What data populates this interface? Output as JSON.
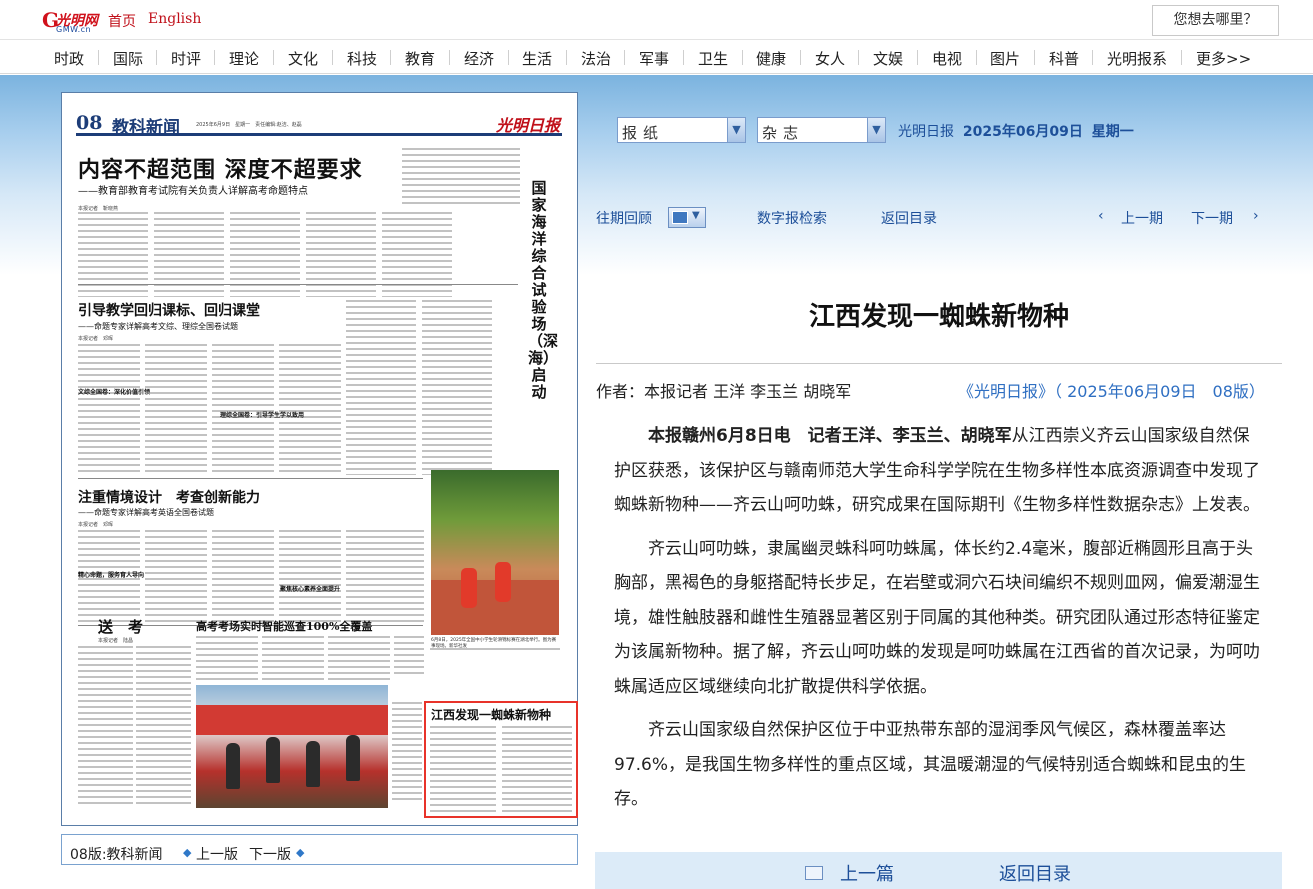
{
  "site": {
    "logo_cn": "光明网",
    "logo_en": "GMW.cn",
    "links": [
      "首页",
      "English"
    ],
    "search_button": "您想去哪里？"
  },
  "nav": {
    "items": [
      "时政",
      "国际",
      "时评",
      "理论",
      "文化",
      "科技",
      "教育",
      "经济",
      "生活",
      "法治",
      "军事",
      "卫生",
      "健康",
      "女人",
      "文娱",
      "电视",
      "图片",
      "科普",
      "光明报系",
      "更多>>"
    ]
  },
  "paper": {
    "page_no": "08",
    "page_name": "教科新闻",
    "meta": "2025年6月9日　星期一　责任编辑:赵洁、赵磊",
    "logo": "光明日报",
    "headline": "内容不超范围 深度不超要求",
    "subhead": "——教育部教育考试院有关负责人详解高考命题特点",
    "byline1": "本报记者　靳晓燕",
    "h2a": "引导教学回归课标、回归课堂",
    "h2a_sub": "——命题专家详解高考文综、理综全国卷试题",
    "byline2": "本报记者　邓晖",
    "h3a": "文综全国卷：深化价值引领",
    "h3b": "理综全国卷：引导学生学以致用",
    "h2b": "注重情境设计　考查创新能力",
    "h2b_sub": "——命题专家详解高考英语全国卷试题",
    "byline3": "本报记者　邓晖",
    "h3c": "精心命题，服务育人导向",
    "h2c": "送　考",
    "byline4": "本报记者　陆昌",
    "h2d": "高考考场实时智能巡查100%全覆盖",
    "h3d": "聚焦核心素养全面提升",
    "vertical_title": "国家海洋综合试验场（深海）启动",
    "photo_caption": "6月8日，2025年全国中小学生轮滑锦标赛在湖北举行。图为赛事现场。新华社发",
    "highlight_title": "江西发现一蜘蛛新物种"
  },
  "paper_nav": {
    "page_label": "08版:教科新闻",
    "prev": "上一版",
    "next": "下一版"
  },
  "selectors": {
    "newspaper": "报纸",
    "magazine": "杂志"
  },
  "date_line": {
    "paper_name": "光明日报",
    "date": "2025年06月09日",
    "weekday": "星期一"
  },
  "toolbar": {
    "history": "往期回顾",
    "search": "数字报检索",
    "back": "返回目录",
    "prev_issue": "上一期",
    "next_issue": "下一期"
  },
  "article": {
    "title": "江西发现一蜘蛛新物种",
    "author": "作者：本报记者 王洋 李玉兰 胡晓军",
    "source": "《光明日报》（ 2025年06月09日　08版）",
    "lead_bold": "本报赣州6月8日电　记者王洋、李玉兰、胡晓军",
    "p1": "从江西崇义齐云山国家级自然保护区获悉，该保护区与赣南师范大学生命科学学院在生物多样性本底资源调查中发现了蜘蛛新物种——齐云山呵叻蛛，研究成果在国际期刊《生物多样性数据杂志》上发表。",
    "p2": "齐云山呵叻蛛，隶属幽灵蛛科呵叻蛛属，体长约2.4毫米，腹部近椭圆形且高于头胸部，黑褐色的身躯搭配特长步足，在岩壁或洞穴石块间编织不规则皿网，偏爱潮湿生境，雄性触肢器和雌性生殖器显著区别于同属的其他种类。研究团队通过形态特征鉴定为该属新物种。据了解，齐云山呵叻蛛的发现是呵叻蛛属在江西省的首次记录，为呵叻蛛属适应区域继续向北扩散提供科学依据。",
    "p3": "齐云山国家级自然保护区位于中亚热带东部的湿润季风气候区，森林覆盖率达97.6%，是我国生物多样性的重点区域，其温暖潮湿的气候特别适合蜘蛛和昆虫的生存。"
  },
  "footer": {
    "prev_article": "上一篇",
    "back": "返回目录"
  }
}
